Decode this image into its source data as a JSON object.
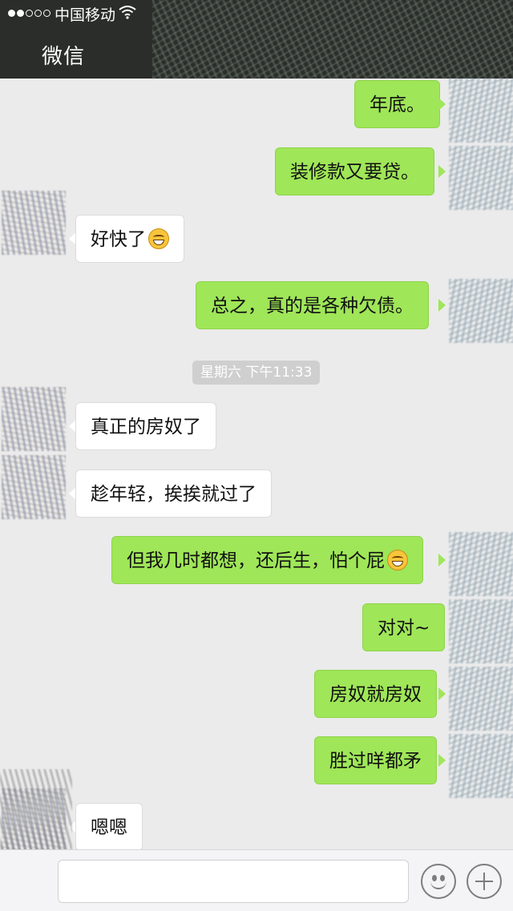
{
  "status_bar": {
    "carrier": "中国移动",
    "signal_bars_filled": 2,
    "signal_bars_total": 5
  },
  "nav": {
    "title": "微信"
  },
  "chat": {
    "timestamp": "星期六 下午11:33",
    "messages": [
      {
        "side": "sent",
        "text": "年底。",
        "emoji": false
      },
      {
        "side": "sent",
        "text": "装修款又要贷。",
        "emoji": false
      },
      {
        "side": "received",
        "text": "好快了",
        "emoji": true,
        "emoji_name": "grin-emoji"
      },
      {
        "side": "sent",
        "text": "总之，真的是各种欠债。",
        "emoji": false
      },
      {
        "side": "received",
        "text": "真正的房奴了",
        "emoji": false
      },
      {
        "side": "received",
        "text": "趁年轻，挨挨就过了",
        "emoji": false
      },
      {
        "side": "sent",
        "text": "但我几时都想，还后生，怕个屁",
        "emoji": true,
        "emoji_name": "grin-emoji"
      },
      {
        "side": "sent",
        "text": "对对~",
        "emoji": false
      },
      {
        "side": "sent",
        "text": "房奴就房奴",
        "emoji": false
      },
      {
        "side": "sent",
        "text": "胜过咩都矛",
        "emoji": false
      },
      {
        "side": "received",
        "text": "嗯嗯",
        "emoji": false
      }
    ]
  },
  "input_bar": {
    "placeholder": "",
    "emoji_button_icon": "smile-icon",
    "more_button_icon": "plus-icon"
  },
  "colors": {
    "sent_bubble": "#9fe658",
    "received_bubble": "#ffffff",
    "chat_background": "#ebebeb",
    "header_background": "#2a2d2a"
  }
}
